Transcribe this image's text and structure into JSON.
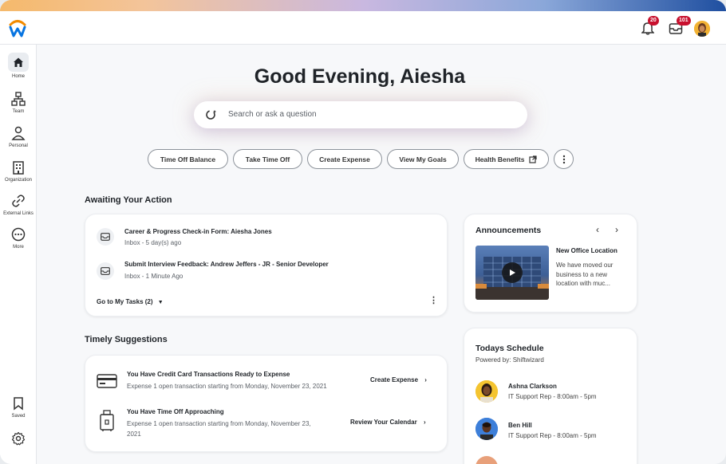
{
  "header": {
    "notifications_count": "20",
    "inbox_count": "101"
  },
  "sidebar": {
    "items": [
      {
        "label": "Home",
        "icon": "home-icon"
      },
      {
        "label": "Team",
        "icon": "team-icon"
      },
      {
        "label": "Personal",
        "icon": "person-icon"
      },
      {
        "label": "Organization",
        "icon": "organization-icon"
      },
      {
        "label": "External Links",
        "icon": "link-icon"
      },
      {
        "label": "More",
        "icon": "more-icon"
      }
    ],
    "saved_label": "Saved"
  },
  "greeting": "Good Evening, Aiesha",
  "search": {
    "placeholder": "Search or ask a question"
  },
  "quick_actions": [
    "Time Off Balance",
    "Take Time Off",
    "Create Expense",
    "View My Goals",
    "Health Benefits"
  ],
  "awaiting": {
    "title": "Awaiting Your Action",
    "tasks": [
      {
        "title": "Career & Progress Check-in Form: Aiesha Jones",
        "sub": "Inbox - 5 day(s) ago"
      },
      {
        "title": "Submit Interview Feedback: Andrew Jeffers - JR - Senior Developer",
        "sub": "Inbox - 1 Minute Ago"
      }
    ],
    "footer_link": "Go to My Tasks (2)"
  },
  "suggestions": {
    "title": "Timely Suggestions",
    "items": [
      {
        "title": "You Have Credit Card Transactions Ready to Expense",
        "sub": "Expense 1 open transaction starting from Monday, November 23, 2021",
        "action": "Create Expense"
      },
      {
        "title": "You Have Time Off Approaching",
        "sub1": "Expense 1 open transaction starting from Monday, November 23,",
        "sub2": "2021",
        "action": "Review Your Calendar"
      }
    ]
  },
  "announcements": {
    "title": "Announcements",
    "item_title": "New Office Location",
    "item_body": [
      "We have moved our",
      "business to a new",
      "location with muc..."
    ]
  },
  "schedule": {
    "title": "Todays Schedule",
    "powered": "Powered by: Shiftwizard",
    "people": [
      {
        "name": "Ashna Clarkson",
        "role": "IT Support Rep - 8:00am - 5pm"
      },
      {
        "name": "Ben Hill",
        "role": "IT Support Rep - 8:00am - 5pm"
      }
    ]
  },
  "colors": {
    "brand_orange": "#f38b00",
    "brand_blue": "#0875e1",
    "badge_red": "#c8102e"
  }
}
